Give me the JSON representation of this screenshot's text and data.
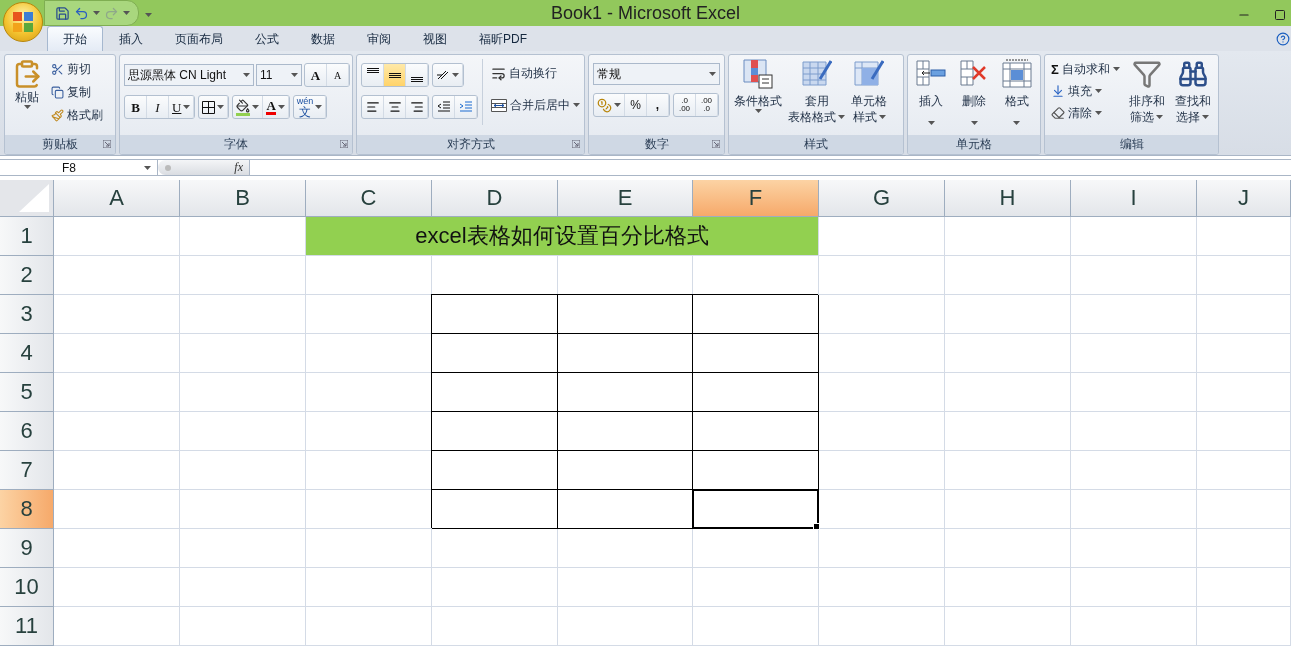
{
  "window": {
    "title": "Book1 - Microsoft Excel"
  },
  "tabs": [
    {
      "label": "开始",
      "selected": true
    },
    {
      "label": "插入",
      "selected": false
    },
    {
      "label": "页面布局",
      "selected": false
    },
    {
      "label": "公式",
      "selected": false
    },
    {
      "label": "数据",
      "selected": false
    },
    {
      "label": "审阅",
      "selected": false
    },
    {
      "label": "视图",
      "selected": false
    },
    {
      "label": "福昕PDF",
      "selected": false
    }
  ],
  "ribbon": [
    {
      "kind": "clipboard",
      "label": "剪贴板",
      "paste": "粘贴",
      "items": [
        "剪切",
        "复制",
        "格式刷"
      ]
    },
    {
      "kind": "font",
      "label": "字体",
      "font_name": "思源黑体 CN Light",
      "font_size": "11",
      "grow": "A",
      "shrink": "A",
      "bold": "B",
      "italic": "I",
      "underline": "U",
      "font_color": "A",
      "phonetic": {
        "pinyin": "wén",
        "char": "文"
      }
    },
    {
      "kind": "alignment",
      "label": "对齐方式",
      "vertical": [
        {
          "selected": false
        },
        {
          "selected": true
        },
        {
          "selected": false
        }
      ],
      "wrap": "自动换行",
      "merge": "合并后居中"
    },
    {
      "kind": "number",
      "label": "数字",
      "format": "常规",
      "percent": "%",
      "comma": ",",
      "decimals": [
        {
          "top": ".0",
          "bottom": ".00"
        },
        {
          "top": ".00",
          "bottom": ".0"
        }
      ]
    },
    {
      "kind": "styles",
      "label": "样式",
      "buttons": [
        {
          "lines": [
            "条件格式"
          ]
        },
        {
          "lines": [
            "套用",
            "表格格式"
          ]
        },
        {
          "lines": [
            "单元格",
            "样式"
          ]
        }
      ]
    },
    {
      "kind": "cells",
      "label": "单元格",
      "buttons": [
        "插入",
        "删除",
        "格式"
      ]
    },
    {
      "kind": "editing",
      "label": "编辑",
      "sigma": "Σ",
      "items": [
        "自动求和",
        "填充",
        "清除"
      ],
      "buttons": [
        {
          "lines": [
            "排序和",
            "筛选"
          ]
        },
        {
          "lines": [
            "查找和",
            "选择"
          ]
        }
      ]
    }
  ],
  "formula_bar": {
    "name_box": "F8",
    "fx": "fx"
  },
  "columns": [
    {
      "label": "A",
      "selected": false
    },
    {
      "label": "B",
      "selected": false
    },
    {
      "label": "C",
      "selected": false
    },
    {
      "label": "D",
      "selected": false
    },
    {
      "label": "E",
      "selected": false
    },
    {
      "label": "F",
      "selected": true
    },
    {
      "label": "G",
      "selected": false
    },
    {
      "label": "H",
      "selected": false
    },
    {
      "label": "I",
      "selected": false
    },
    {
      "label": "J",
      "selected": false
    }
  ],
  "rows": [
    {
      "label": "1",
      "selected": false,
      "cells": [
        {
          "kind": "empty"
        },
        {
          "kind": "empty"
        },
        {
          "kind": "title",
          "text": "excel表格如何设置百分比格式"
        },
        {
          "kind": "merged"
        },
        {
          "kind": "merged"
        },
        {
          "kind": "merged"
        },
        {
          "kind": "empty"
        },
        {
          "kind": "empty"
        },
        {
          "kind": "empty"
        },
        {
          "kind": "empty"
        }
      ]
    },
    {
      "label": "2",
      "selected": false,
      "cells": [
        {
          "kind": "empty"
        },
        {
          "kind": "empty"
        },
        {
          "kind": "empty"
        },
        {
          "kind": "empty"
        },
        {
          "kind": "empty"
        },
        {
          "kind": "empty"
        },
        {
          "kind": "empty"
        },
        {
          "kind": "empty"
        },
        {
          "kind": "empty"
        },
        {
          "kind": "empty"
        }
      ]
    },
    {
      "label": "3",
      "selected": false,
      "cells": [
        {
          "kind": "empty"
        },
        {
          "kind": "empty"
        },
        {
          "kind": "empty"
        },
        {
          "kind": "bordered"
        },
        {
          "kind": "bordered"
        },
        {
          "kind": "bordered"
        },
        {
          "kind": "empty"
        },
        {
          "kind": "empty"
        },
        {
          "kind": "empty"
        },
        {
          "kind": "empty"
        }
      ]
    },
    {
      "label": "4",
      "selected": false,
      "cells": [
        {
          "kind": "empty"
        },
        {
          "kind": "empty"
        },
        {
          "kind": "empty"
        },
        {
          "kind": "bordered"
        },
        {
          "kind": "bordered"
        },
        {
          "kind": "bordered"
        },
        {
          "kind": "empty"
        },
        {
          "kind": "empty"
        },
        {
          "kind": "empty"
        },
        {
          "kind": "empty"
        }
      ]
    },
    {
      "label": "5",
      "selected": false,
      "cells": [
        {
          "kind": "empty"
        },
        {
          "kind": "empty"
        },
        {
          "kind": "empty"
        },
        {
          "kind": "bordered"
        },
        {
          "kind": "bordered"
        },
        {
          "kind": "bordered"
        },
        {
          "kind": "empty"
        },
        {
          "kind": "empty"
        },
        {
          "kind": "empty"
        },
        {
          "kind": "empty"
        }
      ]
    },
    {
      "label": "6",
      "selected": false,
      "cells": [
        {
          "kind": "empty"
        },
        {
          "kind": "empty"
        },
        {
          "kind": "empty"
        },
        {
          "kind": "bordered"
        },
        {
          "kind": "bordered"
        },
        {
          "kind": "bordered"
        },
        {
          "kind": "empty"
        },
        {
          "kind": "empty"
        },
        {
          "kind": "empty"
        },
        {
          "kind": "empty"
        }
      ]
    },
    {
      "label": "7",
      "selected": false,
      "cells": [
        {
          "kind": "empty"
        },
        {
          "kind": "empty"
        },
        {
          "kind": "empty"
        },
        {
          "kind": "bordered"
        },
        {
          "kind": "bordered"
        },
        {
          "kind": "bordered"
        },
        {
          "kind": "empty"
        },
        {
          "kind": "empty"
        },
        {
          "kind": "empty"
        },
        {
          "kind": "empty"
        }
      ]
    },
    {
      "label": "8",
      "selected": true,
      "cells": [
        {
          "kind": "empty"
        },
        {
          "kind": "empty"
        },
        {
          "kind": "empty"
        },
        {
          "kind": "bordered"
        },
        {
          "kind": "bordered"
        },
        {
          "kind": "active"
        },
        {
          "kind": "empty"
        },
        {
          "kind": "empty"
        },
        {
          "kind": "empty"
        },
        {
          "kind": "empty"
        }
      ]
    },
    {
      "label": "9",
      "selected": false,
      "cells": [
        {
          "kind": "empty"
        },
        {
          "kind": "empty"
        },
        {
          "kind": "empty"
        },
        {
          "kind": "empty"
        },
        {
          "kind": "empty"
        },
        {
          "kind": "empty"
        },
        {
          "kind": "empty"
        },
        {
          "kind": "empty"
        },
        {
          "kind": "empty"
        },
        {
          "kind": "empty"
        }
      ]
    },
    {
      "label": "10",
      "selected": false,
      "cells": [
        {
          "kind": "empty"
        },
        {
          "kind": "empty"
        },
        {
          "kind": "empty"
        },
        {
          "kind": "empty"
        },
        {
          "kind": "empty"
        },
        {
          "kind": "empty"
        },
        {
          "kind": "empty"
        },
        {
          "kind": "empty"
        },
        {
          "kind": "empty"
        },
        {
          "kind": "empty"
        }
      ]
    },
    {
      "label": "11",
      "selected": false,
      "cells": [
        {
          "kind": "empty"
        },
        {
          "kind": "empty"
        },
        {
          "kind": "empty"
        },
        {
          "kind": "empty"
        },
        {
          "kind": "empty"
        },
        {
          "kind": "empty"
        },
        {
          "kind": "empty"
        },
        {
          "kind": "empty"
        },
        {
          "kind": "empty"
        },
        {
          "kind": "empty"
        }
      ]
    }
  ]
}
